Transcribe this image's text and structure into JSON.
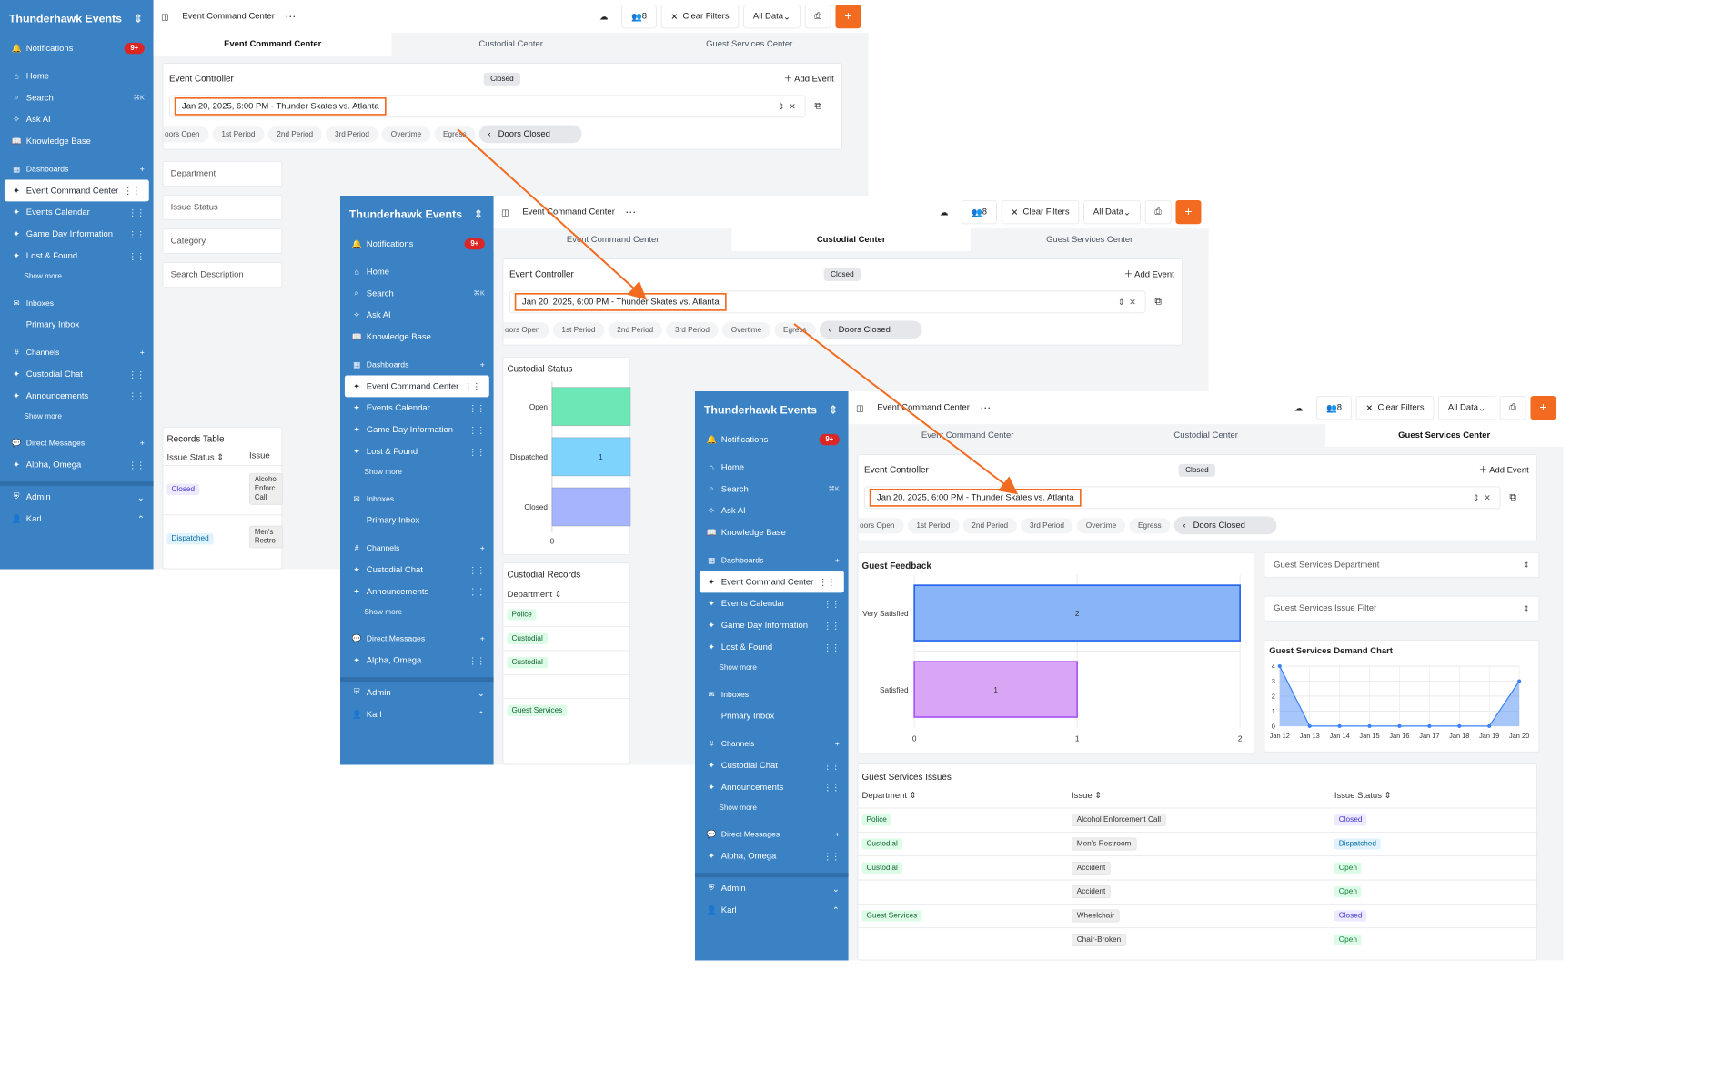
{
  "app": {
    "name": "Thunderhawk Events",
    "notifications_label": "Notifications",
    "notifications_badge": "9+",
    "nav": {
      "home": "Home",
      "search": "Search",
      "search_shortcut": "⌘K",
      "ask_ai": "Ask AI",
      "knowledge_base": "Knowledge Base"
    },
    "dashboards": {
      "label": "Dashboards",
      "items": [
        "Event Command Center",
        "Events Calendar",
        "Game Day Information",
        "Lost & Found"
      ],
      "show_more": "Show more"
    },
    "inboxes": {
      "label": "Inboxes",
      "items": [
        "Primary Inbox"
      ]
    },
    "channels": {
      "label": "Channels",
      "items": [
        "Custodial Chat",
        "Announcements"
      ],
      "show_more": "Show more"
    },
    "direct_messages": {
      "label": "Direct Messages",
      "items": [
        "Alpha, Omega"
      ]
    },
    "admin": "Admin",
    "user": "Karl"
  },
  "topbar": {
    "title": "Event Command Center",
    "members": "8",
    "clear_filters": "Clear Filters",
    "all_data": "All Data",
    "add": "+"
  },
  "tabs": [
    "Event Command Center",
    "Custodial Center",
    "Guest Services Center"
  ],
  "event_controller": {
    "title": "Event Controller",
    "status": "Closed",
    "add_event": "Add Event",
    "selected_event": "Jan 20, 2025, 6:00 PM - Thunder Skates vs. Atlanta",
    "phases": [
      "oors Open",
      "1st Period",
      "2nd Period",
      "3rd Period",
      "Overtime",
      "Egress"
    ],
    "current_phase": "Doors Closed"
  },
  "screen1": {
    "filters": [
      "Department",
      "Issue Status",
      "Category",
      "Search Description"
    ],
    "records_table": {
      "title": "Records Table",
      "headers": [
        "Issue Status",
        "Issue"
      ],
      "rows": [
        {
          "status": "Closed",
          "status_class": "closed",
          "issue": "Alcoho Enforc Call"
        },
        {
          "status": "Dispatched",
          "status_class": "dispatched",
          "issue": "Men's Restro"
        }
      ]
    }
  },
  "screen2": {
    "custodial_status": {
      "title": "Custodial Status"
    },
    "custodial_records": {
      "title": "Custodial Records",
      "header": "Department",
      "rows": [
        "Police",
        "Custodial",
        "Custodial",
        "",
        "Guest Services"
      ]
    }
  },
  "screen3": {
    "guest_feedback": {
      "title": "Guest Feedback"
    },
    "dept_filter": "Guest Services Department",
    "issue_filter": "Guest Services Issue Filter",
    "demand_chart": {
      "title": "Guest Services Demand Chart"
    },
    "issues": {
      "title": "Guest Services Issues",
      "headers": [
        "Department",
        "Issue",
        "Issue Status"
      ],
      "rows": [
        {
          "dept": "Police",
          "issue": "Alcohol Enforcement Call",
          "status": "Closed",
          "status_class": "closed"
        },
        {
          "dept": "Custodial",
          "issue": "Men's Restroom",
          "status": "Dispatched",
          "status_class": "dispatched"
        },
        {
          "dept": "Custodial",
          "issue": "Accident",
          "status": "Open",
          "status_class": "open"
        },
        {
          "dept": "",
          "issue": "Accident",
          "status": "Open",
          "status_class": "open"
        },
        {
          "dept": "Guest Services",
          "issue": "Wheelchair",
          "status": "Closed",
          "status_class": "closed"
        },
        {
          "dept": "",
          "issue": "Chair-Broken",
          "status": "Open",
          "status_class": "open"
        }
      ]
    }
  },
  "chart_data": [
    {
      "type": "bar",
      "title": "Custodial Status",
      "orientation": "horizontal",
      "categories": [
        "Open",
        "Dispatched",
        "Closed"
      ],
      "values": [
        null,
        1,
        null
      ],
      "x_ticks": [
        "0"
      ],
      "colors": [
        "#6ee7b7",
        "#7dd3fc",
        "#a5b4fc"
      ]
    },
    {
      "type": "bar",
      "title": "Guest Feedback",
      "orientation": "horizontal",
      "categories": [
        "Very Satisfied",
        "Satisfied"
      ],
      "values": [
        2,
        1
      ],
      "xlim": [
        0,
        2
      ],
      "x_ticks": [
        "0",
        "1",
        "2"
      ],
      "colors": [
        "#8ab4f8",
        "#d8a6f5"
      ]
    },
    {
      "type": "area",
      "title": "Guest Services Demand Chart",
      "x": [
        "Jan 12",
        "Jan 13",
        "Jan 14",
        "Jan 15",
        "Jan 16",
        "Jan 17",
        "Jan 18",
        "Jan 19",
        "Jan 20"
      ],
      "y": [
        4,
        0,
        0,
        0,
        0,
        0,
        0,
        0,
        3
      ],
      "ylim": [
        0,
        4
      ],
      "y_ticks": [
        "0",
        "1",
        "2",
        "3",
        "4"
      ],
      "color": "#3b82f6"
    }
  ],
  "colors": {
    "sidebar": "#3b82c4",
    "accent": "#f26b21",
    "highlight": "#f26b21"
  }
}
